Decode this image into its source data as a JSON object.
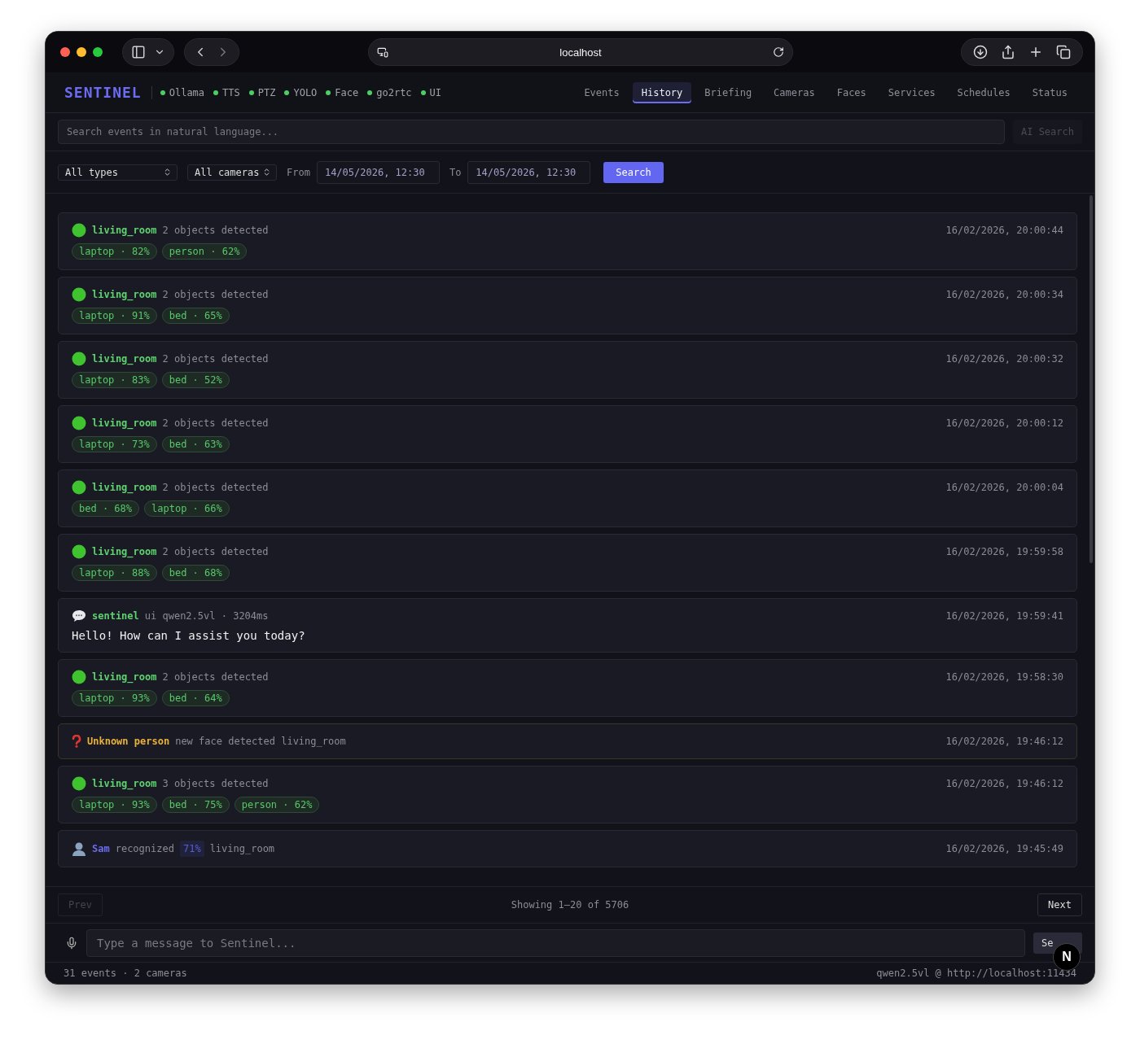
{
  "browser": {
    "address": "localhost"
  },
  "app": {
    "logo": "SENTINEL",
    "services": [
      {
        "name": "Ollama"
      },
      {
        "name": "TTS"
      },
      {
        "name": "PTZ"
      },
      {
        "name": "YOLO"
      },
      {
        "name": "Face"
      },
      {
        "name": "go2rtc"
      },
      {
        "name": "UI"
      }
    ],
    "tabs": [
      {
        "label": "Events",
        "selected": false
      },
      {
        "label": "History",
        "selected": true
      },
      {
        "label": "Briefing",
        "selected": false
      },
      {
        "label": "Cameras",
        "selected": false
      },
      {
        "label": "Faces",
        "selected": false
      },
      {
        "label": "Services",
        "selected": false
      },
      {
        "label": "Schedules",
        "selected": false
      },
      {
        "label": "Status",
        "selected": false
      }
    ]
  },
  "search": {
    "placeholder": "Search events in natural language...",
    "button": "AI Search"
  },
  "filters": {
    "type": "All types",
    "camera": "All cameras",
    "from_label": "From",
    "from": "14/05/2026, 12:30",
    "to_label": "To",
    "to": "14/05/2026, 12:30",
    "button": "Search"
  },
  "events": [
    {
      "kind": "detection",
      "camera": "living_room",
      "summary": "2 objects detected",
      "time": "16/02/2026, 20:00:44",
      "tags": [
        "laptop · 82%",
        "person · 62%"
      ]
    },
    {
      "kind": "detection",
      "camera": "living_room",
      "summary": "2 objects detected",
      "time": "16/02/2026, 20:00:34",
      "tags": [
        "laptop · 91%",
        "bed · 65%"
      ]
    },
    {
      "kind": "detection",
      "camera": "living_room",
      "summary": "2 objects detected",
      "time": "16/02/2026, 20:00:32",
      "tags": [
        "laptop · 83%",
        "bed · 52%"
      ]
    },
    {
      "kind": "detection",
      "camera": "living_room",
      "summary": "2 objects detected",
      "time": "16/02/2026, 20:00:12",
      "tags": [
        "laptop · 73%",
        "bed · 63%"
      ]
    },
    {
      "kind": "detection",
      "camera": "living_room",
      "summary": "2 objects detected",
      "time": "16/02/2026, 20:00:04",
      "tags": [
        "bed · 68%",
        "laptop · 66%"
      ]
    },
    {
      "kind": "detection",
      "camera": "living_room",
      "summary": "2 objects detected",
      "time": "16/02/2026, 19:59:58",
      "tags": [
        "laptop · 88%",
        "bed · 68%"
      ]
    },
    {
      "kind": "chat",
      "source": "sentinel",
      "meta": "ui qwen2.5vl · 3204ms",
      "message": "Hello! How can I assist you today?",
      "time": "16/02/2026, 19:59:41"
    },
    {
      "kind": "detection",
      "camera": "living_room",
      "summary": "2 objects detected",
      "time": "16/02/2026, 19:58:30",
      "tags": [
        "laptop · 93%",
        "bed · 64%"
      ]
    },
    {
      "kind": "unknown_face",
      "name": "Unknown person",
      "summary": "new face detected living_room",
      "time": "16/02/2026, 19:46:12"
    },
    {
      "kind": "detection",
      "camera": "living_room",
      "summary": "3 objects detected",
      "time": "16/02/2026, 19:46:12",
      "tags": [
        "laptop · 93%",
        "bed · 75%",
        "person · 62%"
      ]
    },
    {
      "kind": "known_face",
      "name": "Sam",
      "summary": "recognized",
      "confidence": "71%",
      "camera": "living_room",
      "time": "16/02/2026, 19:45:49"
    }
  ],
  "pagination": {
    "prev": "Prev",
    "prev_disabled": true,
    "info": "Showing 1–20 of 5706",
    "next": "Next"
  },
  "chat": {
    "placeholder": "Type a message to Sentinel...",
    "send": "Se"
  },
  "dev_badge": "N",
  "status_bar": {
    "left": "31 events · 2 cameras",
    "right": "qwen2.5vl @ http://localhost:11434"
  }
}
